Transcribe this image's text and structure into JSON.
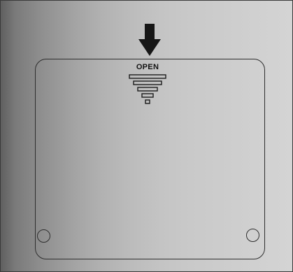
{
  "cover": {
    "label": "OPEN"
  },
  "icons": {
    "arrow": "arrow-down-icon",
    "slide": "slide-direction-icon",
    "screw": "screw-icon"
  },
  "colors": {
    "outline": "#2e2e2e",
    "surface_dark": "#5f5f5f",
    "surface_light": "#d4d4d4"
  }
}
